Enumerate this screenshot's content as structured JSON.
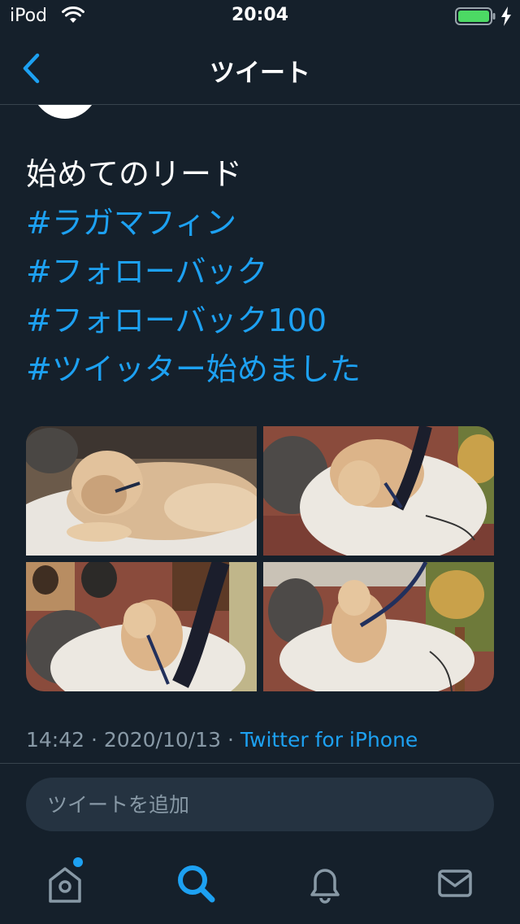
{
  "status_bar": {
    "device": "iPod",
    "time": "20:04",
    "battery_color": "#4cd964"
  },
  "nav": {
    "title": "ツイート",
    "back_icon": "chevron-left-icon"
  },
  "tweet": {
    "lines": [
      {
        "text": "始めてのリード",
        "kind": "text"
      },
      {
        "text": "#ラガマフィン",
        "kind": "hashtag"
      },
      {
        "text": "#フォローバック",
        "kind": "hashtag"
      },
      {
        "text": "#フォローバック100",
        "kind": "hashtag"
      },
      {
        "text": "#ツイッター始めました",
        "kind": "hashtag"
      }
    ],
    "time": "14:42",
    "separator": "·",
    "date": "2020/10/13",
    "source": "Twitter for iPhone"
  },
  "reply": {
    "placeholder": "ツイートを追加"
  },
  "tab_bar": {
    "tabs": [
      {
        "name": "home",
        "icon": "home-icon",
        "active": false,
        "badge": true
      },
      {
        "name": "search",
        "icon": "search-icon",
        "active": true,
        "badge": false
      },
      {
        "name": "notifications",
        "icon": "bell-icon",
        "active": false,
        "badge": false
      },
      {
        "name": "messages",
        "icon": "mail-icon",
        "active": false,
        "badge": false
      }
    ]
  },
  "colors": {
    "background": "#15202b",
    "accent": "#1da1f2",
    "secondary_text": "#8899a6",
    "divider": "#38444d",
    "input_bg": "#253341"
  }
}
